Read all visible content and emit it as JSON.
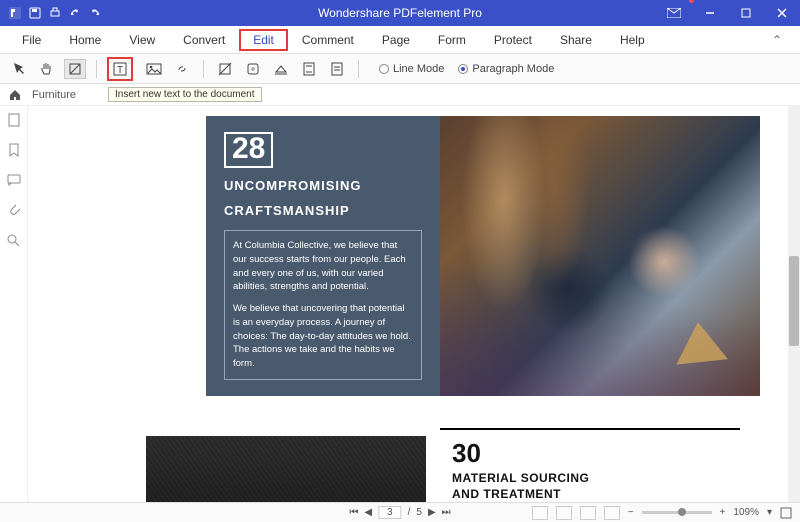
{
  "app": {
    "title": "Wondershare PDFelement Pro"
  },
  "titlebar_icons": {
    "logo": "logo",
    "save": "save",
    "print": "print",
    "undo": "undo",
    "redo": "redo",
    "mail": "mail",
    "min": "minimize",
    "max": "maximize",
    "close": "close"
  },
  "menu": {
    "items": [
      "File",
      "Home",
      "View",
      "Convert",
      "Edit",
      "Comment",
      "Page",
      "Form",
      "Protect",
      "Share",
      "Help"
    ],
    "active": "Edit"
  },
  "ribbon": {
    "tools": {
      "select": "select",
      "hand": "hand",
      "edit_object": "edit-object",
      "add_text": "add-text",
      "add_image": "add-image",
      "link": "link",
      "crop": "crop",
      "watermark": "watermark",
      "background": "background",
      "header_footer": "header-footer",
      "bates": "bates"
    },
    "modes": {
      "line": "Line Mode",
      "paragraph": "Paragraph Mode",
      "selected": "paragraph"
    }
  },
  "tooltip": "Insert new text to the document",
  "breadcrumb": {
    "doc": "Furniture"
  },
  "sidepanel": {
    "thumbnails": "thumbnails",
    "bookmarks": "bookmarks",
    "comments": "comments",
    "attachments": "attachments",
    "search": "search"
  },
  "document": {
    "block28": {
      "num": "28",
      "heading_l1": "UNCOMPROMISING",
      "heading_l2": "CRAFTSMANSHIP",
      "para1": "At Columbia Collective, we believe that our success starts from our people. Each and every one of us, with our varied abilities, strengths and potential.",
      "para2": "We believe that uncovering that potential is an everyday process. A journey of choices: The day-to-day attitudes we hold. The actions we take and the habits we form."
    },
    "block30": {
      "num": "30",
      "heading_l1": "MATERIAL SOURCING",
      "heading_l2": "AND TREATMENT"
    }
  },
  "status": {
    "page_current": "3",
    "page_total": "5",
    "zoom": "109%"
  }
}
